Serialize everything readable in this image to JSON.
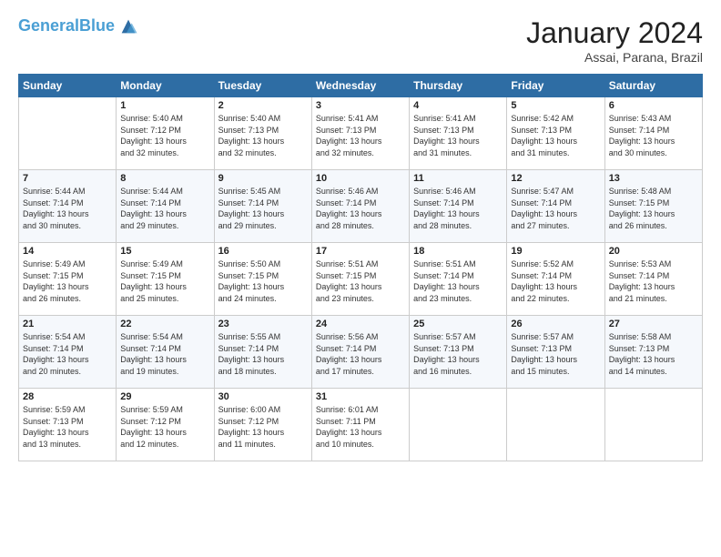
{
  "header": {
    "logo_line1": "General",
    "logo_line2": "Blue",
    "month_title": "January 2024",
    "location": "Assai, Parana, Brazil"
  },
  "days_of_week": [
    "Sunday",
    "Monday",
    "Tuesday",
    "Wednesday",
    "Thursday",
    "Friday",
    "Saturday"
  ],
  "weeks": [
    [
      {
        "day": "",
        "info": ""
      },
      {
        "day": "1",
        "info": "Sunrise: 5:40 AM\nSunset: 7:12 PM\nDaylight: 13 hours\nand 32 minutes."
      },
      {
        "day": "2",
        "info": "Sunrise: 5:40 AM\nSunset: 7:13 PM\nDaylight: 13 hours\nand 32 minutes."
      },
      {
        "day": "3",
        "info": "Sunrise: 5:41 AM\nSunset: 7:13 PM\nDaylight: 13 hours\nand 32 minutes."
      },
      {
        "day": "4",
        "info": "Sunrise: 5:41 AM\nSunset: 7:13 PM\nDaylight: 13 hours\nand 31 minutes."
      },
      {
        "day": "5",
        "info": "Sunrise: 5:42 AM\nSunset: 7:13 PM\nDaylight: 13 hours\nand 31 minutes."
      },
      {
        "day": "6",
        "info": "Sunrise: 5:43 AM\nSunset: 7:14 PM\nDaylight: 13 hours\nand 30 minutes."
      }
    ],
    [
      {
        "day": "7",
        "info": "Sunrise: 5:44 AM\nSunset: 7:14 PM\nDaylight: 13 hours\nand 30 minutes."
      },
      {
        "day": "8",
        "info": "Sunrise: 5:44 AM\nSunset: 7:14 PM\nDaylight: 13 hours\nand 29 minutes."
      },
      {
        "day": "9",
        "info": "Sunrise: 5:45 AM\nSunset: 7:14 PM\nDaylight: 13 hours\nand 29 minutes."
      },
      {
        "day": "10",
        "info": "Sunrise: 5:46 AM\nSunset: 7:14 PM\nDaylight: 13 hours\nand 28 minutes."
      },
      {
        "day": "11",
        "info": "Sunrise: 5:46 AM\nSunset: 7:14 PM\nDaylight: 13 hours\nand 28 minutes."
      },
      {
        "day": "12",
        "info": "Sunrise: 5:47 AM\nSunset: 7:14 PM\nDaylight: 13 hours\nand 27 minutes."
      },
      {
        "day": "13",
        "info": "Sunrise: 5:48 AM\nSunset: 7:15 PM\nDaylight: 13 hours\nand 26 minutes."
      }
    ],
    [
      {
        "day": "14",
        "info": "Sunrise: 5:49 AM\nSunset: 7:15 PM\nDaylight: 13 hours\nand 26 minutes."
      },
      {
        "day": "15",
        "info": "Sunrise: 5:49 AM\nSunset: 7:15 PM\nDaylight: 13 hours\nand 25 minutes."
      },
      {
        "day": "16",
        "info": "Sunrise: 5:50 AM\nSunset: 7:15 PM\nDaylight: 13 hours\nand 24 minutes."
      },
      {
        "day": "17",
        "info": "Sunrise: 5:51 AM\nSunset: 7:15 PM\nDaylight: 13 hours\nand 23 minutes."
      },
      {
        "day": "18",
        "info": "Sunrise: 5:51 AM\nSunset: 7:14 PM\nDaylight: 13 hours\nand 23 minutes."
      },
      {
        "day": "19",
        "info": "Sunrise: 5:52 AM\nSunset: 7:14 PM\nDaylight: 13 hours\nand 22 minutes."
      },
      {
        "day": "20",
        "info": "Sunrise: 5:53 AM\nSunset: 7:14 PM\nDaylight: 13 hours\nand 21 minutes."
      }
    ],
    [
      {
        "day": "21",
        "info": "Sunrise: 5:54 AM\nSunset: 7:14 PM\nDaylight: 13 hours\nand 20 minutes."
      },
      {
        "day": "22",
        "info": "Sunrise: 5:54 AM\nSunset: 7:14 PM\nDaylight: 13 hours\nand 19 minutes."
      },
      {
        "day": "23",
        "info": "Sunrise: 5:55 AM\nSunset: 7:14 PM\nDaylight: 13 hours\nand 18 minutes."
      },
      {
        "day": "24",
        "info": "Sunrise: 5:56 AM\nSunset: 7:14 PM\nDaylight: 13 hours\nand 17 minutes."
      },
      {
        "day": "25",
        "info": "Sunrise: 5:57 AM\nSunset: 7:13 PM\nDaylight: 13 hours\nand 16 minutes."
      },
      {
        "day": "26",
        "info": "Sunrise: 5:57 AM\nSunset: 7:13 PM\nDaylight: 13 hours\nand 15 minutes."
      },
      {
        "day": "27",
        "info": "Sunrise: 5:58 AM\nSunset: 7:13 PM\nDaylight: 13 hours\nand 14 minutes."
      }
    ],
    [
      {
        "day": "28",
        "info": "Sunrise: 5:59 AM\nSunset: 7:13 PM\nDaylight: 13 hours\nand 13 minutes."
      },
      {
        "day": "29",
        "info": "Sunrise: 5:59 AM\nSunset: 7:12 PM\nDaylight: 13 hours\nand 12 minutes."
      },
      {
        "day": "30",
        "info": "Sunrise: 6:00 AM\nSunset: 7:12 PM\nDaylight: 13 hours\nand 11 minutes."
      },
      {
        "day": "31",
        "info": "Sunrise: 6:01 AM\nSunset: 7:11 PM\nDaylight: 13 hours\nand 10 minutes."
      },
      {
        "day": "",
        "info": ""
      },
      {
        "day": "",
        "info": ""
      },
      {
        "day": "",
        "info": ""
      }
    ]
  ]
}
